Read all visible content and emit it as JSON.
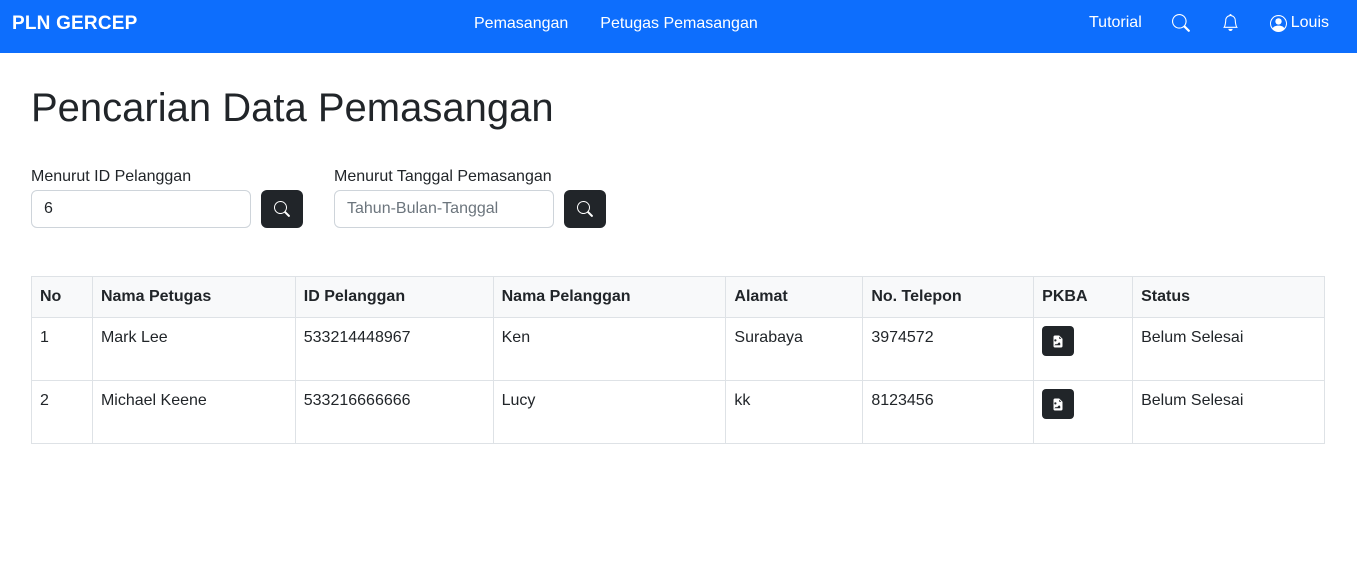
{
  "navbar": {
    "brand": "PLN GERCEP",
    "links": [
      "Pemasangan",
      "Petugas Pemasangan"
    ],
    "tutorial": "Tutorial",
    "user": "Louis"
  },
  "page": {
    "title": "Pencarian Data Pemasangan"
  },
  "search": {
    "id_label": "Menurut ID Pelanggan",
    "id_value": "6",
    "date_label": "Menurut Tanggal Pemasangan",
    "date_placeholder": "Tahun-Bulan-Tanggal"
  },
  "table": {
    "headers": [
      "No",
      "Nama Petugas",
      "ID Pelanggan",
      "Nama Pelanggan",
      "Alamat",
      "No. Telepon",
      "PKBA",
      "Status"
    ],
    "rows": [
      [
        "1",
        "Mark Lee",
        "533214448967",
        "Ken",
        "Surabaya",
        "3974572",
        "",
        "Belum Selesai"
      ],
      [
        "2",
        "Michael Keene",
        "533216666666",
        "Lucy",
        "kk",
        "8123456",
        "",
        "Belum Selesai"
      ]
    ]
  },
  "colors": {
    "primary": "#0d6efd",
    "dark": "#212529"
  },
  "icons": [
    "search-icon",
    "bell-icon",
    "user-circle-icon",
    "file-image-icon"
  ]
}
